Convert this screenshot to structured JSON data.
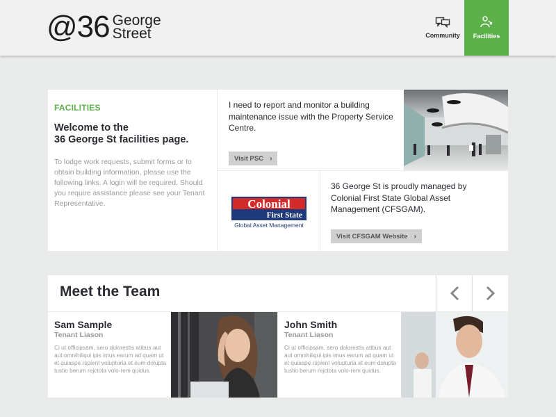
{
  "header": {
    "logo_main": "@36",
    "logo_line1": "George",
    "logo_line2": "Street",
    "nav": [
      {
        "label": "Community",
        "icon": "speech-bubbles-icon"
      },
      {
        "label": "Facilities",
        "icon": "person-with-tools-icon",
        "active": true
      }
    ]
  },
  "intro": {
    "section_label": "FACILITIES",
    "welcome_line1": "Welcome to the",
    "welcome_line2": "36 George St facilities page.",
    "body": "To lodge work requests, submit forms or to obtain building information, please use the following links. A login will be required. Should you require assistance please see your Tenant Representative."
  },
  "psc": {
    "text": "I need to report and monitor a building maintenance issue with the Property Service Centre.",
    "button_label": "Visit PSC"
  },
  "cfs": {
    "logo_line1": "Colonial",
    "logo_line2": "First State",
    "logo_line3": "Global Asset Management",
    "text": "36 George St is proudly managed by Colonial First State Global Asset Management (CFSGAM).",
    "button_label": "Visit CFSGAM Website"
  },
  "team": {
    "title": "Meet the Team",
    "members": [
      {
        "name": "Sam Sample",
        "role": "Tenant Liason",
        "bio": "Ci ut officipsam, sero dolorestis atibus aut aut omnihiliqui ipis imus earum ad quam ut et quiaspe rspient volupturia et eum dolupta tustio berum rejctota volo-rem quidus."
      },
      {
        "name": "John Smith",
        "role": "Tenant Liason",
        "bio": "Ci ut officipsam, sero dolorestis atibus aut aut omnihiliqui ipis imus earum ad quam ut et quiaspe rspient volupturia et eum dolupta tustio berum rejctota volo-rem quidus."
      }
    ]
  },
  "colors": {
    "accent": "#5cb14b",
    "background": "#e9eaea",
    "button": "#cfd0d0",
    "colonial_red": "#d32a2a",
    "colonial_blue": "#1e3a7a"
  }
}
